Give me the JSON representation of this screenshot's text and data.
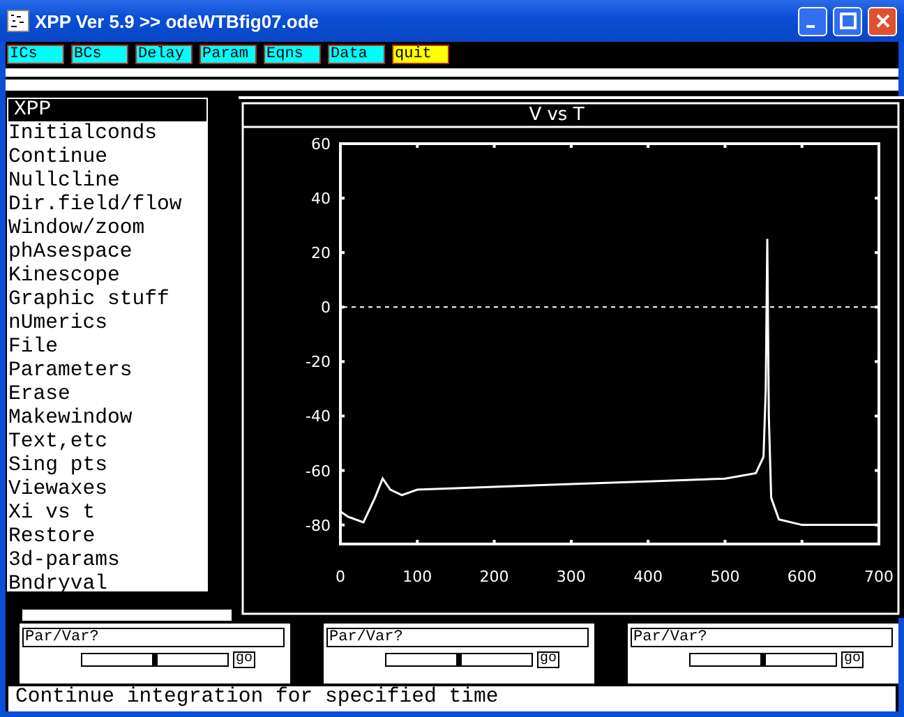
{
  "window": {
    "title": "XPP Ver 5.9 >> odeWTBfig07.ode"
  },
  "menubar": [
    {
      "label": "ICs",
      "color": "#00ffff"
    },
    {
      "label": "BCs",
      "color": "#00ffff"
    },
    {
      "label": "Delay",
      "color": "#00ffff"
    },
    {
      "label": "Param",
      "color": "#00ffff"
    },
    {
      "label": "Eqns",
      "color": "#00ffff"
    },
    {
      "label": "Data",
      "color": "#00ffff"
    },
    {
      "label": "quit",
      "color": "#ffff00"
    }
  ],
  "sidebar": {
    "title": "XPP",
    "items": [
      "Initialconds",
      "Continue",
      "Nullcline",
      "Dir.field/flow",
      "Window/zoom",
      "phAsespace",
      "Kinescope",
      "Graphic stuff",
      "nUmerics",
      "File",
      "Parameters",
      "Erase",
      "Makewindow",
      "Text,etc",
      "Sing pts",
      "Viewaxes",
      "Xi vs t",
      "Restore",
      "3d-params",
      "Bndryval"
    ]
  },
  "graph": {
    "chart_data": {
      "type": "line",
      "title": "V vs T",
      "x": [
        0,
        10,
        30,
        45,
        55,
        65,
        80,
        100,
        200,
        300,
        400,
        500,
        540,
        550,
        553,
        555,
        557,
        560,
        570,
        600,
        700
      ],
      "series": [
        {
          "color": "#ffffff",
          "values": [
            -75,
            -77,
            -79,
            -70,
            -63,
            -67,
            -69,
            -67,
            -66,
            -65,
            -64,
            -63,
            -61,
            -55,
            -30,
            25,
            -40,
            -70,
            -78,
            -80,
            -80
          ]
        }
      ],
      "xlim": [
        0,
        700
      ],
      "ylim": [
        -87,
        60
      ],
      "xticks": [
        0,
        100,
        200,
        300,
        400,
        500,
        600,
        700
      ],
      "yticks": [
        -80,
        -60,
        -40,
        -20,
        0,
        20,
        40,
        60
      ]
    }
  },
  "sliders": [
    {
      "field": "Par/Var?",
      "level": 0.5,
      "button": "go"
    },
    {
      "field": "Par/Var?",
      "level": 0.5,
      "button": "go"
    },
    {
      "field": "Par/Var?",
      "level": 0.5,
      "button": "go"
    }
  ],
  "status_bar": "Continue integration for specified time"
}
